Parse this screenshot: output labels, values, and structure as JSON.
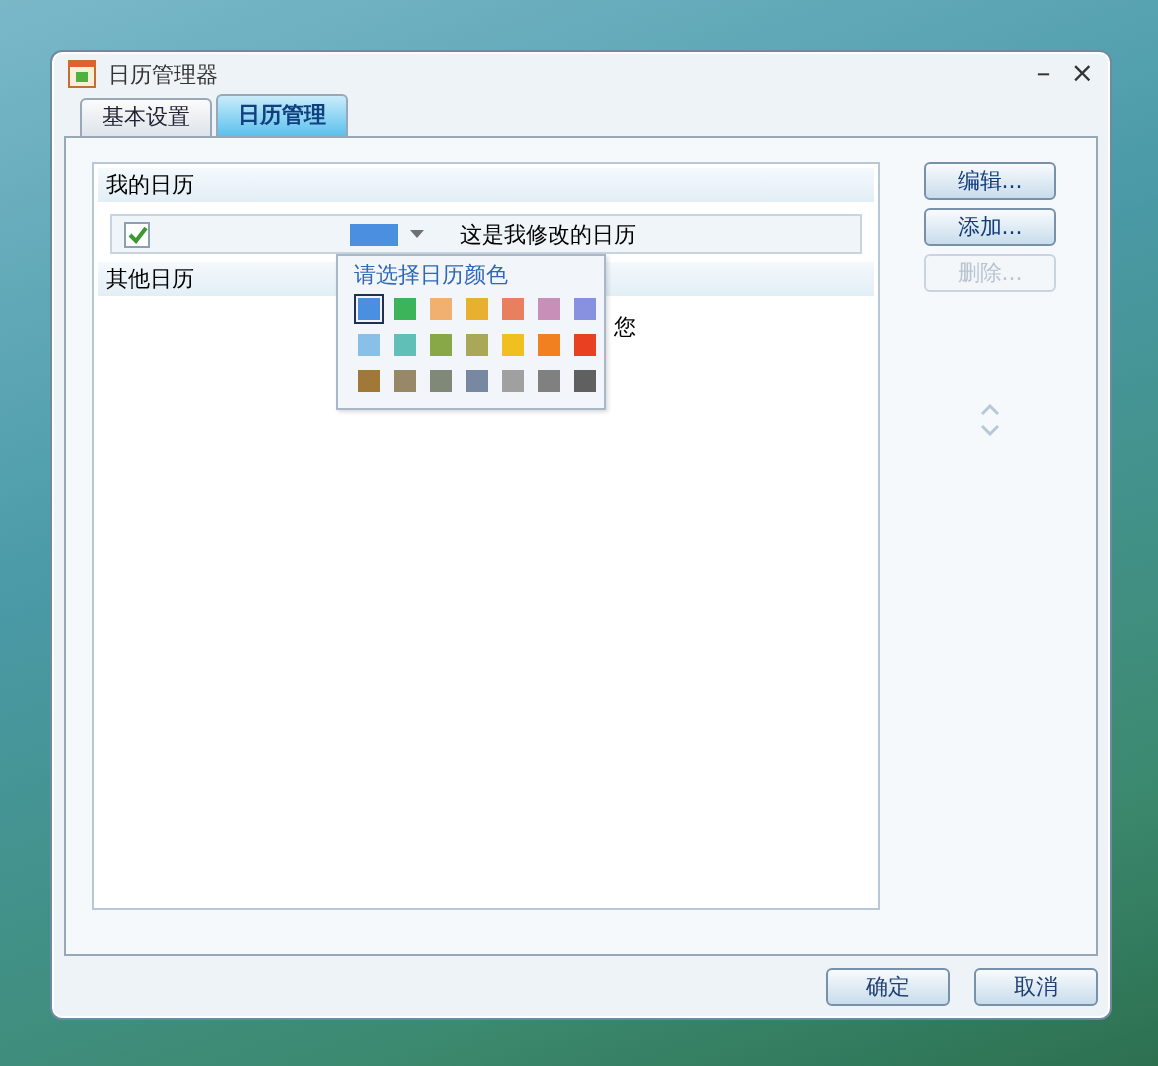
{
  "window": {
    "title": "日历管理器",
    "minimize": "–",
    "close": "×"
  },
  "tabs": [
    {
      "label": "基本设置",
      "selected": false
    },
    {
      "label": "日历管理",
      "selected": true
    }
  ],
  "my_calendars": {
    "header": "我的日历",
    "items": [
      {
        "checked": true,
        "color": "#4a8fe0",
        "name": "这是我修改的日历"
      }
    ]
  },
  "other_calendars": {
    "header": "其他日历",
    "text": "您"
  },
  "color_popup": {
    "title": "请选择日历颜色",
    "colors": [
      {
        "color": "#4a8fe0",
        "selected": true
      },
      {
        "color": "#3cb45a",
        "selected": false
      },
      {
        "color": "#f0b070",
        "selected": false
      },
      {
        "color": "#e8b030",
        "selected": false
      },
      {
        "color": "#e88060",
        "selected": false
      },
      {
        "color": "#c890b8",
        "selected": false
      },
      {
        "color": "#8890e0",
        "selected": false
      },
      {
        "color": "#88c0e8",
        "selected": false
      },
      {
        "color": "#60c0b8",
        "selected": false
      },
      {
        "color": "#88a848",
        "selected": false
      },
      {
        "color": "#a8a858",
        "selected": false
      },
      {
        "color": "#f0c020",
        "selected": false
      },
      {
        "color": "#f08020",
        "selected": false
      },
      {
        "color": "#e84020",
        "selected": false
      },
      {
        "color": "#a07838",
        "selected": false
      },
      {
        "color": "#988868",
        "selected": false
      },
      {
        "color": "#808878",
        "selected": false
      },
      {
        "color": "#7888a0",
        "selected": false
      },
      {
        "color": "#a0a0a0",
        "selected": false
      },
      {
        "color": "#808080",
        "selected": false
      },
      {
        "color": "#606060",
        "selected": false
      }
    ]
  },
  "side_buttons": [
    {
      "label": "编辑...",
      "disabled": false
    },
    {
      "label": "添加...",
      "disabled": false
    },
    {
      "label": "删除...",
      "disabled": true
    }
  ],
  "footer_buttons": [
    "确定",
    "取消"
  ]
}
